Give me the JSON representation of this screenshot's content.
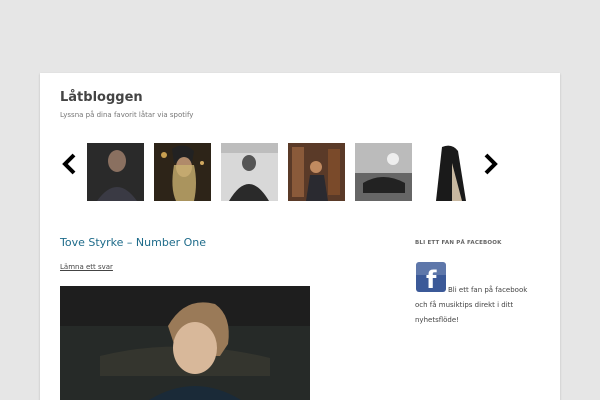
{
  "site": {
    "title": "Låtbloggen",
    "description": "Lyssna på dina favorit låtar via spotify"
  },
  "carousel": {
    "prev_icon": "chevron-left-icon",
    "next_icon": "chevron-right-icon",
    "thumbnails": [
      "thumbnail-1",
      "thumbnail-2",
      "thumbnail-3",
      "thumbnail-4",
      "thumbnail-5",
      "thumbnail-6"
    ]
  },
  "post": {
    "title": "Tove Styrke – Number One",
    "comment_link": "Lämna ett svar"
  },
  "sidebar": {
    "widget_title": "BLI ETT FAN PÅ FACEBOOK",
    "fb_icon": "facebook-icon",
    "fb_text": "Bli ett fan på facebook och få musiktips direkt i ditt nyhetsflöde!"
  },
  "colors": {
    "background": "#e6e6e6",
    "link": "#1e6b8a",
    "facebook": "#3b5998"
  }
}
